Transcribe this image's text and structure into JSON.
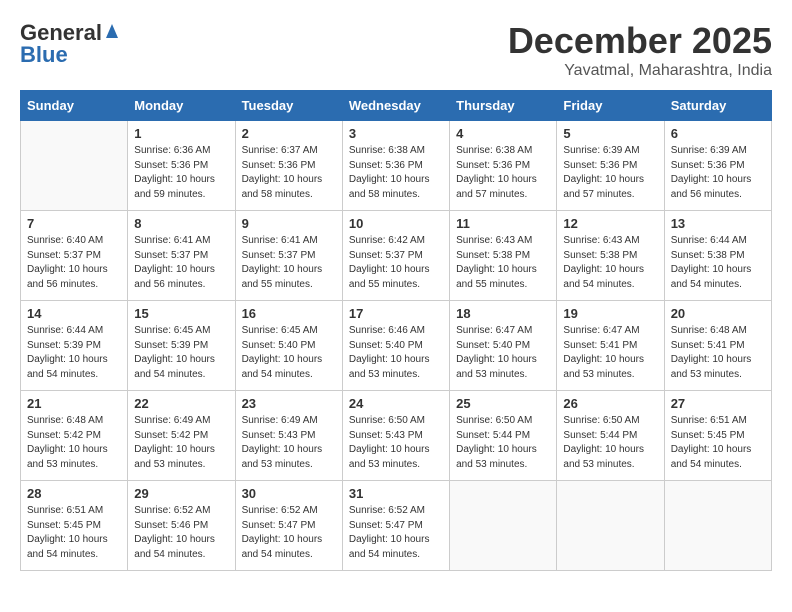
{
  "header": {
    "logo_general": "General",
    "logo_blue": "Blue",
    "month_title": "December 2025",
    "location": "Yavatmal, Maharashtra, India"
  },
  "weekdays": [
    "Sunday",
    "Monday",
    "Tuesday",
    "Wednesday",
    "Thursday",
    "Friday",
    "Saturday"
  ],
  "weeks": [
    [
      {
        "day": "",
        "info": ""
      },
      {
        "day": "1",
        "info": "Sunrise: 6:36 AM\nSunset: 5:36 PM\nDaylight: 10 hours\nand 59 minutes."
      },
      {
        "day": "2",
        "info": "Sunrise: 6:37 AM\nSunset: 5:36 PM\nDaylight: 10 hours\nand 58 minutes."
      },
      {
        "day": "3",
        "info": "Sunrise: 6:38 AM\nSunset: 5:36 PM\nDaylight: 10 hours\nand 58 minutes."
      },
      {
        "day": "4",
        "info": "Sunrise: 6:38 AM\nSunset: 5:36 PM\nDaylight: 10 hours\nand 57 minutes."
      },
      {
        "day": "5",
        "info": "Sunrise: 6:39 AM\nSunset: 5:36 PM\nDaylight: 10 hours\nand 57 minutes."
      },
      {
        "day": "6",
        "info": "Sunrise: 6:39 AM\nSunset: 5:36 PM\nDaylight: 10 hours\nand 56 minutes."
      }
    ],
    [
      {
        "day": "7",
        "info": "Sunrise: 6:40 AM\nSunset: 5:37 PM\nDaylight: 10 hours\nand 56 minutes."
      },
      {
        "day": "8",
        "info": "Sunrise: 6:41 AM\nSunset: 5:37 PM\nDaylight: 10 hours\nand 56 minutes."
      },
      {
        "day": "9",
        "info": "Sunrise: 6:41 AM\nSunset: 5:37 PM\nDaylight: 10 hours\nand 55 minutes."
      },
      {
        "day": "10",
        "info": "Sunrise: 6:42 AM\nSunset: 5:37 PM\nDaylight: 10 hours\nand 55 minutes."
      },
      {
        "day": "11",
        "info": "Sunrise: 6:43 AM\nSunset: 5:38 PM\nDaylight: 10 hours\nand 55 minutes."
      },
      {
        "day": "12",
        "info": "Sunrise: 6:43 AM\nSunset: 5:38 PM\nDaylight: 10 hours\nand 54 minutes."
      },
      {
        "day": "13",
        "info": "Sunrise: 6:44 AM\nSunset: 5:38 PM\nDaylight: 10 hours\nand 54 minutes."
      }
    ],
    [
      {
        "day": "14",
        "info": "Sunrise: 6:44 AM\nSunset: 5:39 PM\nDaylight: 10 hours\nand 54 minutes."
      },
      {
        "day": "15",
        "info": "Sunrise: 6:45 AM\nSunset: 5:39 PM\nDaylight: 10 hours\nand 54 minutes."
      },
      {
        "day": "16",
        "info": "Sunrise: 6:45 AM\nSunset: 5:40 PM\nDaylight: 10 hours\nand 54 minutes."
      },
      {
        "day": "17",
        "info": "Sunrise: 6:46 AM\nSunset: 5:40 PM\nDaylight: 10 hours\nand 53 minutes."
      },
      {
        "day": "18",
        "info": "Sunrise: 6:47 AM\nSunset: 5:40 PM\nDaylight: 10 hours\nand 53 minutes."
      },
      {
        "day": "19",
        "info": "Sunrise: 6:47 AM\nSunset: 5:41 PM\nDaylight: 10 hours\nand 53 minutes."
      },
      {
        "day": "20",
        "info": "Sunrise: 6:48 AM\nSunset: 5:41 PM\nDaylight: 10 hours\nand 53 minutes."
      }
    ],
    [
      {
        "day": "21",
        "info": "Sunrise: 6:48 AM\nSunset: 5:42 PM\nDaylight: 10 hours\nand 53 minutes."
      },
      {
        "day": "22",
        "info": "Sunrise: 6:49 AM\nSunset: 5:42 PM\nDaylight: 10 hours\nand 53 minutes."
      },
      {
        "day": "23",
        "info": "Sunrise: 6:49 AM\nSunset: 5:43 PM\nDaylight: 10 hours\nand 53 minutes."
      },
      {
        "day": "24",
        "info": "Sunrise: 6:50 AM\nSunset: 5:43 PM\nDaylight: 10 hours\nand 53 minutes."
      },
      {
        "day": "25",
        "info": "Sunrise: 6:50 AM\nSunset: 5:44 PM\nDaylight: 10 hours\nand 53 minutes."
      },
      {
        "day": "26",
        "info": "Sunrise: 6:50 AM\nSunset: 5:44 PM\nDaylight: 10 hours\nand 53 minutes."
      },
      {
        "day": "27",
        "info": "Sunrise: 6:51 AM\nSunset: 5:45 PM\nDaylight: 10 hours\nand 54 minutes."
      }
    ],
    [
      {
        "day": "28",
        "info": "Sunrise: 6:51 AM\nSunset: 5:45 PM\nDaylight: 10 hours\nand 54 minutes."
      },
      {
        "day": "29",
        "info": "Sunrise: 6:52 AM\nSunset: 5:46 PM\nDaylight: 10 hours\nand 54 minutes."
      },
      {
        "day": "30",
        "info": "Sunrise: 6:52 AM\nSunset: 5:47 PM\nDaylight: 10 hours\nand 54 minutes."
      },
      {
        "day": "31",
        "info": "Sunrise: 6:52 AM\nSunset: 5:47 PM\nDaylight: 10 hours\nand 54 minutes."
      },
      {
        "day": "",
        "info": ""
      },
      {
        "day": "",
        "info": ""
      },
      {
        "day": "",
        "info": ""
      }
    ]
  ]
}
